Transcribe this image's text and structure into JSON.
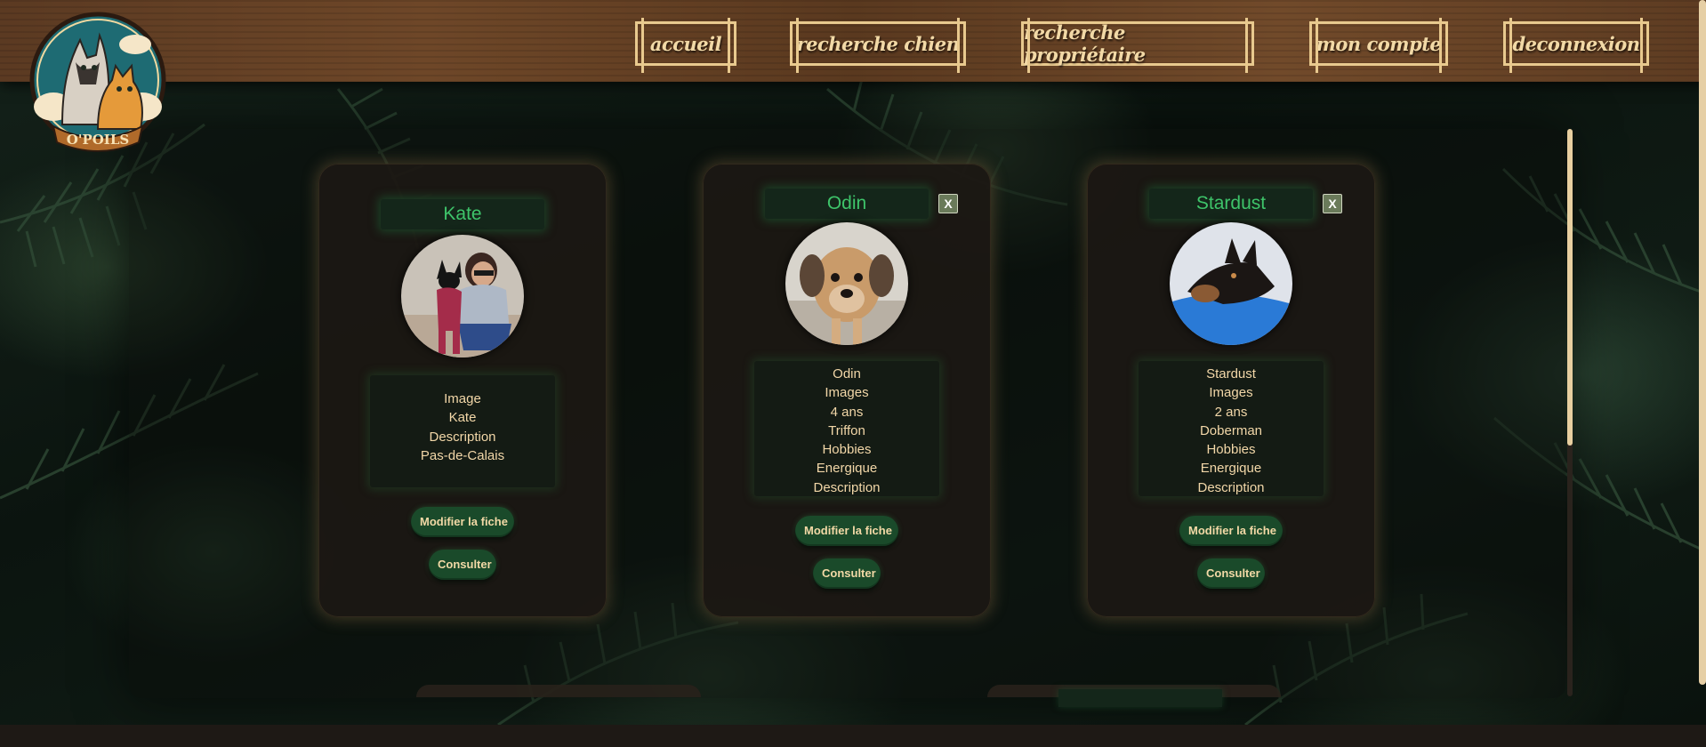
{
  "brand": {
    "logo_text": "O'POILS"
  },
  "nav": [
    {
      "label": "accueil"
    },
    {
      "label": "recherche chien"
    },
    {
      "label": "recherche propriétaire"
    },
    {
      "label": "mon compte"
    },
    {
      "label": "deconnexion"
    }
  ],
  "cards": [
    {
      "name": "Kate",
      "has_close": false,
      "info": [
        "Image",
        "Kate",
        "Description",
        "Pas-de-Calais"
      ],
      "edit_label": "Modifier la fiche",
      "view_label": "Consulter"
    },
    {
      "name": "Odin",
      "has_close": true,
      "close_label": "X",
      "info": [
        "Odin",
        "Images",
        "4 ans",
        "Triffon",
        "Hobbies",
        "Energique",
        "Description"
      ],
      "edit_label": "Modifier la fiche",
      "view_label": "Consulter"
    },
    {
      "name": "Stardust",
      "has_close": true,
      "close_label": "X",
      "info": [
        "Stardust",
        "Images",
        "2 ans",
        "Doberman",
        "Hobbies",
        "Energique",
        "Description"
      ],
      "edit_label": "Modifier la fiche",
      "view_label": "Consulter"
    }
  ],
  "colors": {
    "accent_green": "#3ec46a",
    "button_green": "#1a4a2a",
    "cream_text": "#f2d7a8",
    "wood": "#6e4728"
  }
}
